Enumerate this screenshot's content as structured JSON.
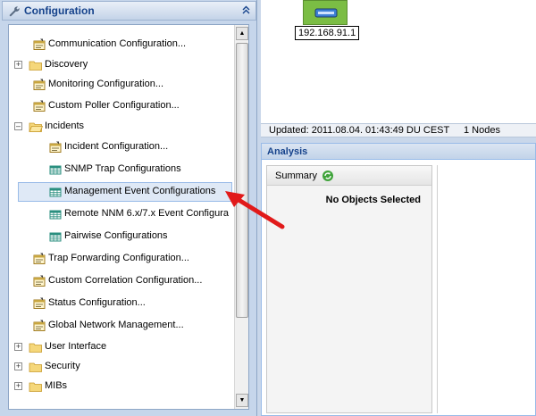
{
  "panel": {
    "title": "Configuration"
  },
  "tree": [
    {
      "label": "Communication Configuration...",
      "type": "config-form",
      "level": 1
    },
    {
      "label": "Discovery",
      "type": "folder",
      "level": 0,
      "expander": "+"
    },
    {
      "label": "Monitoring Configuration...",
      "type": "config-form",
      "level": 1
    },
    {
      "label": "Custom Poller Configuration...",
      "type": "config-form",
      "level": 1
    },
    {
      "label": "Incidents",
      "type": "folder-open",
      "level": 0,
      "expander": "-"
    },
    {
      "label": "Incident Configuration...",
      "type": "config-form",
      "level": 2
    },
    {
      "label": "SNMP Trap Configurations",
      "type": "table",
      "level": 2
    },
    {
      "label": "Management Event Configurations",
      "type": "table",
      "level": 2,
      "selected": true
    },
    {
      "label": "Remote NNM 6.x/7.x Event Configura",
      "type": "table",
      "level": 2
    },
    {
      "label": "Pairwise Configurations",
      "type": "table",
      "level": 2
    },
    {
      "label": "Trap Forwarding Configuration...",
      "type": "config-form",
      "level": 1
    },
    {
      "label": "Custom Correlation Configuration...",
      "type": "config-form",
      "level": 1
    },
    {
      "label": "Status Configuration...",
      "type": "config-form",
      "level": 1
    },
    {
      "label": "Global Network Management...",
      "type": "config-form",
      "level": 1
    },
    {
      "label": "User Interface",
      "type": "folder",
      "level": 0,
      "expander": "+"
    },
    {
      "label": "Security",
      "type": "folder",
      "level": 0,
      "expander": "+"
    },
    {
      "label": "MIBs",
      "type": "folder",
      "level": 0,
      "expander": "+"
    }
  ],
  "topology": {
    "node_label": "192.168.91.1"
  },
  "status": {
    "updated": "Updated: 2011.08.04. 01:43:49 DU CEST",
    "nodes": "1 Nodes"
  },
  "analysis": {
    "title": "Analysis",
    "summary_label": "Summary",
    "no_objects": "No Objects Selected"
  },
  "colors": {
    "header_text": "#15428b",
    "node_green": "#7bbd44",
    "arrow_red": "#e11a1a",
    "selection": "#dfe9f6"
  }
}
